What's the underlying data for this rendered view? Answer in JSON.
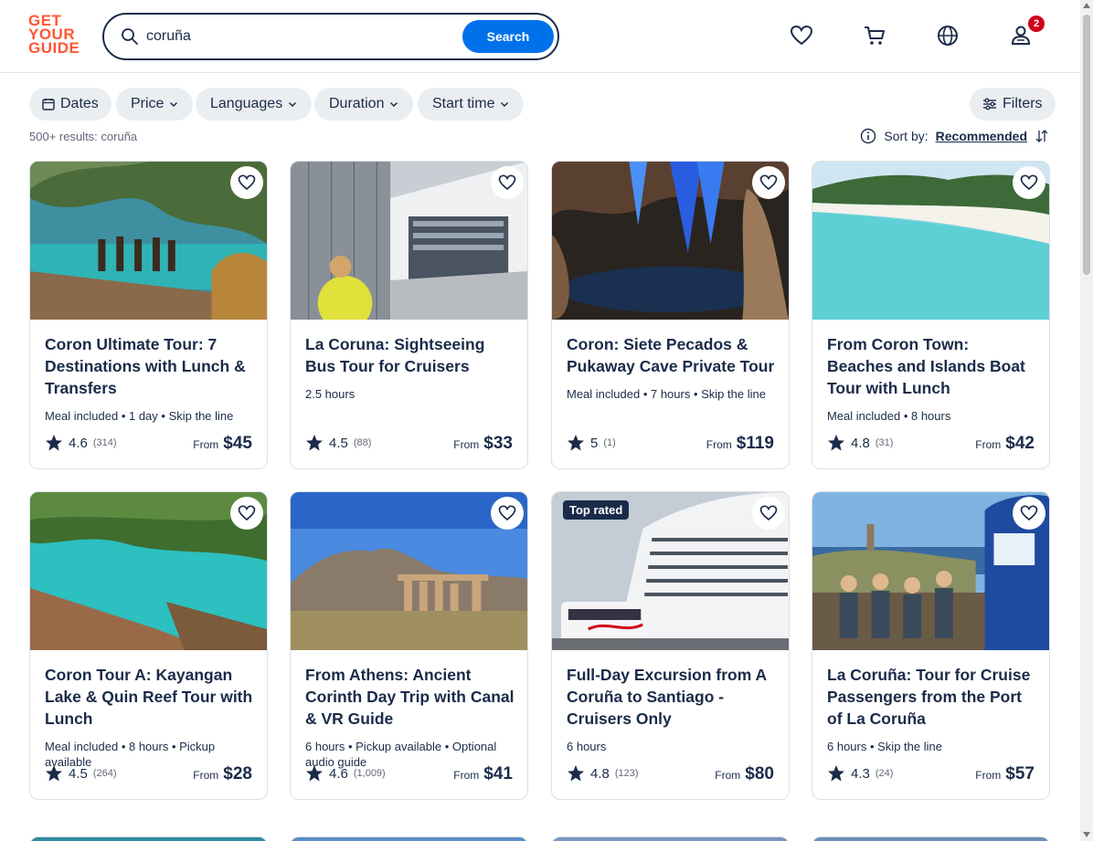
{
  "header": {
    "logo_lines": [
      "GET",
      "YOUR",
      "GUIDE"
    ],
    "search_value": "coruña",
    "search_button": "Search",
    "cart_badge": "2"
  },
  "filters": [
    {
      "label": "Dates",
      "icon": "calendar-icon"
    },
    {
      "label": "Price"
    },
    {
      "label": "Languages"
    },
    {
      "label": "Duration"
    },
    {
      "label": "Start time"
    }
  ],
  "filters_button": "Filters",
  "results_text": "500+ results: coruña",
  "sort": {
    "label": "Sort by:",
    "value": "Recommended"
  },
  "cards": [
    {
      "title": "Coron Ultimate Tour: 7 Destinations with Lunch & Transfers",
      "meta": "Meal included • 1 day • Skip the line",
      "rating": "4.6",
      "count": "(314)",
      "from": "From",
      "price": "$45"
    },
    {
      "title": "La Coruna: Sightseeing Bus Tour for Cruisers",
      "meta": "2.5 hours",
      "rating": "4.5",
      "count": "(88)",
      "from": "From",
      "price": "$33"
    },
    {
      "title": "Coron: Siete Pecados & Pukaway Cave Private Tour",
      "meta": "Meal included • 7 hours • Skip the line",
      "rating": "5",
      "count": "(1)",
      "from": "From",
      "price": "$119"
    },
    {
      "title": "From Coron Town: Beaches and Islands Boat Tour with Lunch",
      "meta": "Meal included • 8 hours",
      "rating": "4.8",
      "count": "(31)",
      "from": "From",
      "price": "$42"
    },
    {
      "title": "Coron Tour A: Kayangan Lake & Quin Reef Tour with Lunch",
      "meta": "Meal included • 8 hours • Pickup available",
      "rating": "4.5",
      "count": "(264)",
      "from": "From",
      "price": "$28"
    },
    {
      "title": "From Athens: Ancient Corinth Day Trip with Canal & VR Guide",
      "meta": "6 hours • Pickup available • Optional audio guide",
      "rating": "4.6",
      "count": "(1,009)",
      "from": "From",
      "price": "$41"
    },
    {
      "title": "Full-Day Excursion from A Coruña to Santiago - Cruisers Only",
      "meta": "6 hours",
      "rating": "4.8",
      "count": "(123)",
      "from": "From",
      "price": "$80",
      "badge": "Top rated"
    },
    {
      "title": "La Coruña: Tour for Cruise Passengers from the Port of La Coruña",
      "meta": "6 hours • Skip the line",
      "rating": "4.3",
      "count": "(24)",
      "from": "From",
      "price": "$57"
    }
  ]
}
